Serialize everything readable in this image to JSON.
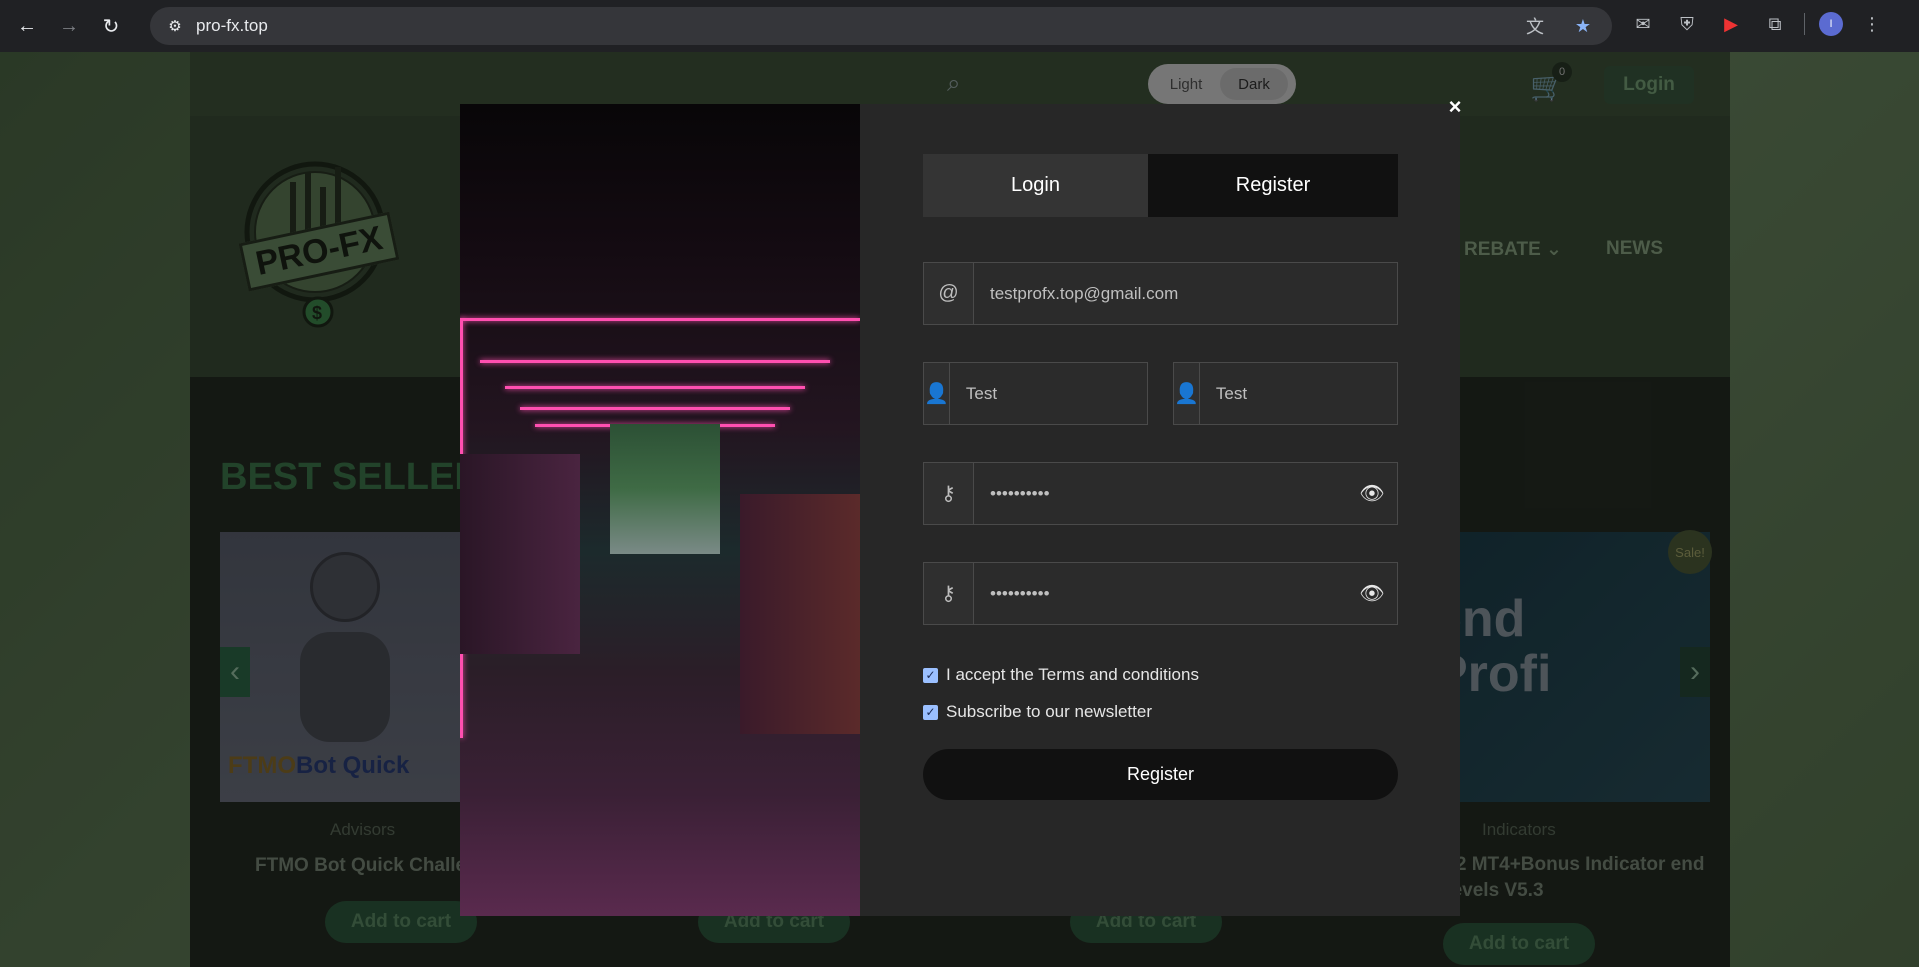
{
  "browser": {
    "url": "pro-fx.top",
    "avatar_initial": "I"
  },
  "site": {
    "theme_toggle": {
      "light": "Light",
      "dark": "Dark"
    },
    "cart_count": "0",
    "login_label": "Login",
    "logo_text": "PRO-FX",
    "nav": {
      "rebate": "O REBATE ⌄",
      "news": "NEWS"
    },
    "section_title": "BEST SELLERS",
    "products": [
      {
        "category": "Advisors",
        "name": "FTMO Bot Quick Challe",
        "image_text_1": "FTMO",
        "image_text_2": "Bot Quick",
        "cart_label": "Add to cart"
      },
      {
        "cart_label": "Add to cart"
      },
      {
        "cart_label": "Add to cart"
      },
      {
        "category": "Indicators",
        "name": "5.2 MT4+Bonus Indicator end Levels V5.3",
        "image_text": "end\nProfi",
        "sale": "Sale!",
        "cart_label": "Add to cart"
      }
    ]
  },
  "modal": {
    "close": "×",
    "tabs": [
      {
        "label": "Login",
        "active": false
      },
      {
        "label": "Register",
        "active": true
      }
    ],
    "email": {
      "icon": "at-icon",
      "value": "testprofx.top@gmail.com"
    },
    "first_name": {
      "icon": "user-icon",
      "value": "Test"
    },
    "last_name": {
      "icon": "user-icon",
      "value": "Test"
    },
    "password": {
      "icon": "key-icon",
      "value": "••••••••••"
    },
    "password_confirm": {
      "icon": "key-icon",
      "value": "••••••••••"
    },
    "terms_label": "I accept the Terms and conditions",
    "newsletter_label": "Subscribe to our newsletter",
    "register_button": "Register"
  }
}
